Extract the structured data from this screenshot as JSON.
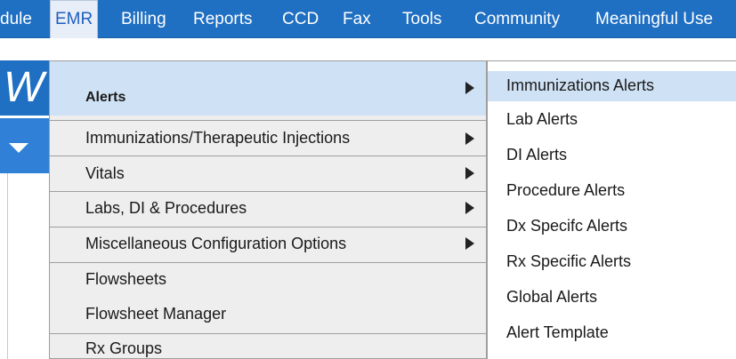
{
  "menubar": {
    "items": [
      {
        "label": "dule"
      },
      {
        "label": "EMR"
      },
      {
        "label": "Billing"
      },
      {
        "label": "Reports"
      },
      {
        "label": "CCD"
      },
      {
        "label": "Fax"
      },
      {
        "label": "Tools"
      },
      {
        "label": "Community"
      },
      {
        "label": "Meaningful Use"
      }
    ]
  },
  "header": {
    "title_fragment": "W"
  },
  "emr_menu": {
    "items": [
      {
        "label": "Alerts"
      },
      {
        "label": "Immunizations/Therapeutic Injections"
      },
      {
        "label": "Vitals"
      },
      {
        "label": "Labs, DI & Procedures"
      },
      {
        "label": "Miscellaneous Configuration Options"
      },
      {
        "label": "Flowsheets"
      },
      {
        "label": "Flowsheet Manager"
      },
      {
        "label": "Rx Groups"
      }
    ]
  },
  "alerts_submenu": {
    "items": [
      {
        "label": "Immunizations Alerts"
      },
      {
        "label": "Lab Alerts"
      },
      {
        "label": "DI Alerts"
      },
      {
        "label": "Procedure Alerts"
      },
      {
        "label": "Dx Specifc Alerts"
      },
      {
        "label": "Rx Specific Alerts"
      },
      {
        "label": "Global Alerts"
      },
      {
        "label": "Alert Template"
      }
    ]
  },
  "colors": {
    "menubar_bg": "#1f6fc2",
    "highlight": "#cfe1f4",
    "dropdown_bg": "#eeeeee"
  }
}
